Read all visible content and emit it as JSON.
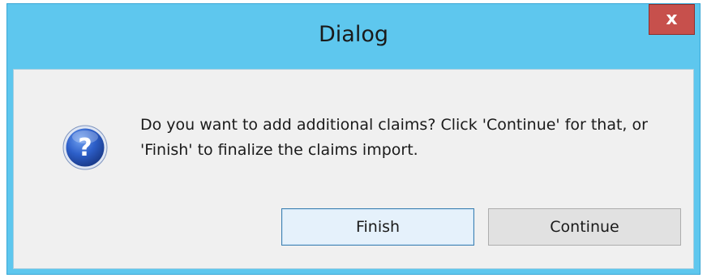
{
  "window": {
    "title": "Dialog",
    "close_glyph": "x",
    "colors": {
      "titlebar": "#5ec7ee",
      "close_button": "#c7504c",
      "client_background": "#f0f0f0"
    }
  },
  "dialog": {
    "icon": "question-icon",
    "message": "Do you want to add additional claims? Click 'Continue' for that, or 'Finish' to finalize the claims import."
  },
  "buttons": {
    "finish_label": "Finish",
    "continue_label": "Continue"
  }
}
